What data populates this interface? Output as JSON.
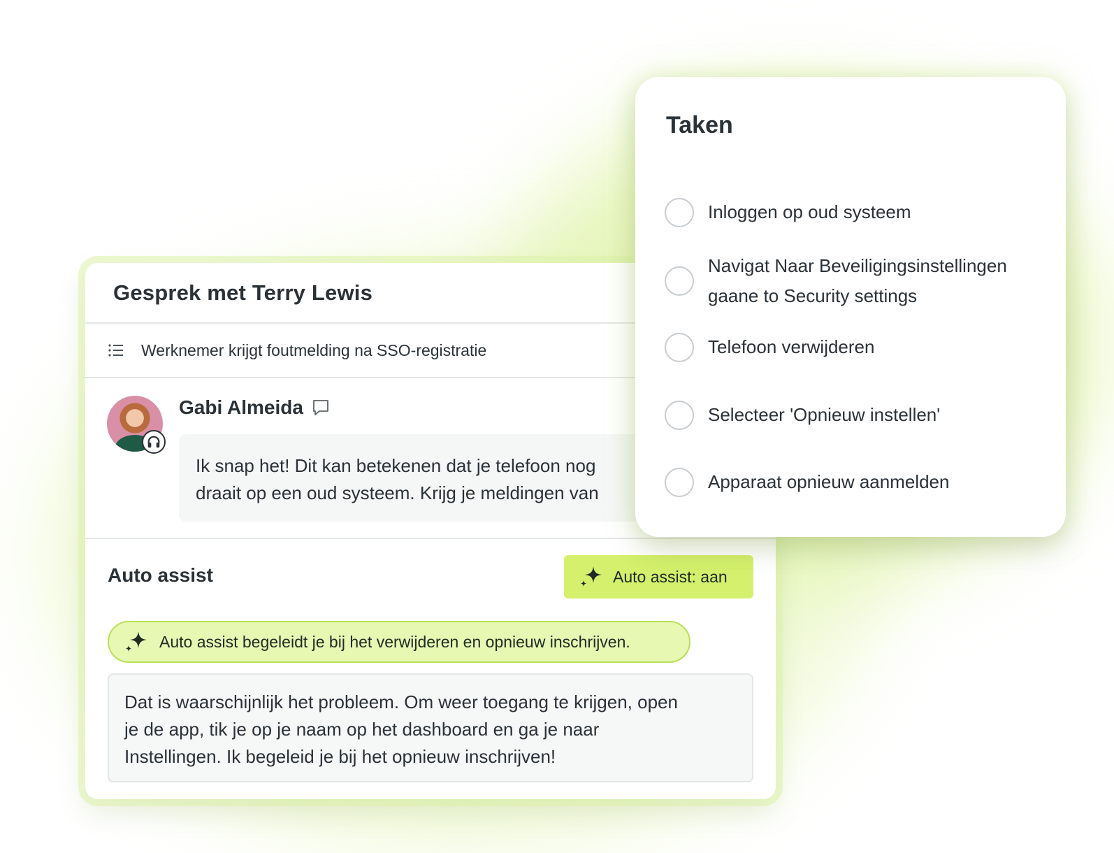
{
  "conversation": {
    "title": "Gesprek met Terry Lewis",
    "subject": "Werknemer krijgt foutmelding na SSO-registratie",
    "message": {
      "sender": "Gabi Almeida",
      "text": "Ik snap het! Dit kan betekenen dat je telefoon nog\ndraait op een oud systeem. Krijg je meldingen van"
    }
  },
  "auto_assist": {
    "label": "Auto assist",
    "toggle_label": "Auto assist: aan",
    "notice": "Auto assist begeleidt je bij het verwijderen en opnieuw inschrijven.",
    "suggestion": "Dat is waarschijnlijk het probleem. Om weer toegang te krijgen, open\nje de app, tik je op je naam op het dashboard en ga je naar\nInstellingen. Ik begeleid je bij het opnieuw inschrijven!"
  },
  "tasks": {
    "title": "Taken",
    "items": [
      {
        "label": "Inloggen op oud systeem",
        "checked": false
      },
      {
        "label": "Navigat Naar Beveiligingsinstellingen\ngaane to Security settings",
        "checked": false
      },
      {
        "label": "Telefoon verwijderen",
        "checked": false
      },
      {
        "label": "Selecteer 'Opnieuw instellen'",
        "checked": false
      },
      {
        "label": "Apparaat opnieuw aanmelden",
        "checked": false
      }
    ]
  },
  "colors": {
    "accent": "#d4f06c",
    "notice_background": "#e6f8b2",
    "text": "#2a3137"
  },
  "icons": [
    "list-icon",
    "comment-icon",
    "headset-icon",
    "sparkle-icon",
    "checkbox-circle-icon"
  ]
}
